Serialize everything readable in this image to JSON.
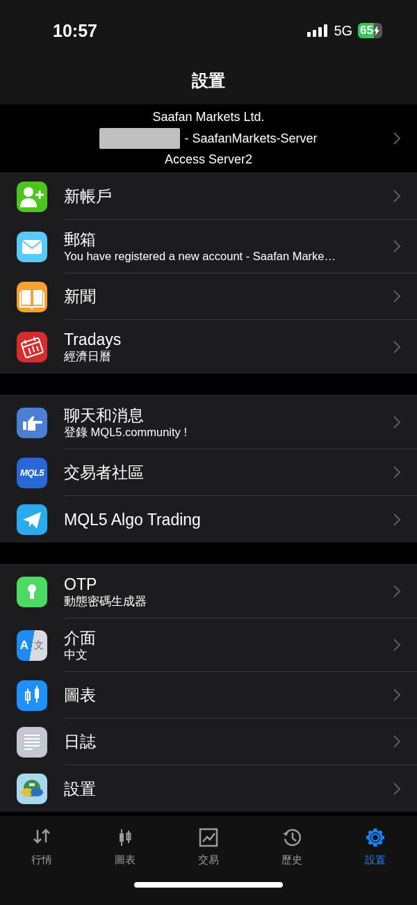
{
  "status_bar": {
    "time": "10:57",
    "network": "5G",
    "battery": "65"
  },
  "title": "設置",
  "account": {
    "broker": "Saafan Markets Ltd.",
    "server": "- SaafanMarkets-Server",
    "access": "Access Server2"
  },
  "groups": [
    [
      {
        "title": "新帳戶"
      },
      {
        "title": "郵箱",
        "subtitle": "You have registered a new account - Saafan Marke…"
      },
      {
        "title": "新聞"
      },
      {
        "title": "Tradays",
        "subtitle": "經濟日曆"
      }
    ],
    [
      {
        "title": "聊天和消息",
        "subtitle": "登錄 MQL5.community !"
      },
      {
        "title": "交易者社區",
        "logo_text": "MQL5"
      },
      {
        "title": "MQL5 Algo Trading"
      }
    ],
    [
      {
        "title": "OTP",
        "subtitle": "動態密碼生成器"
      },
      {
        "title": "介面",
        "subtitle": "中文",
        "icon_glyphs": [
          "A",
          "文"
        ]
      },
      {
        "title": "圖表"
      },
      {
        "title": "日誌"
      },
      {
        "title": "設置"
      }
    ]
  ],
  "tab_bar": [
    {
      "label": "行情",
      "selected": false
    },
    {
      "label": "圖表",
      "selected": false
    },
    {
      "label": "交易",
      "selected": false
    },
    {
      "label": "歷史",
      "selected": false
    },
    {
      "label": "設置",
      "selected": true
    }
  ]
}
